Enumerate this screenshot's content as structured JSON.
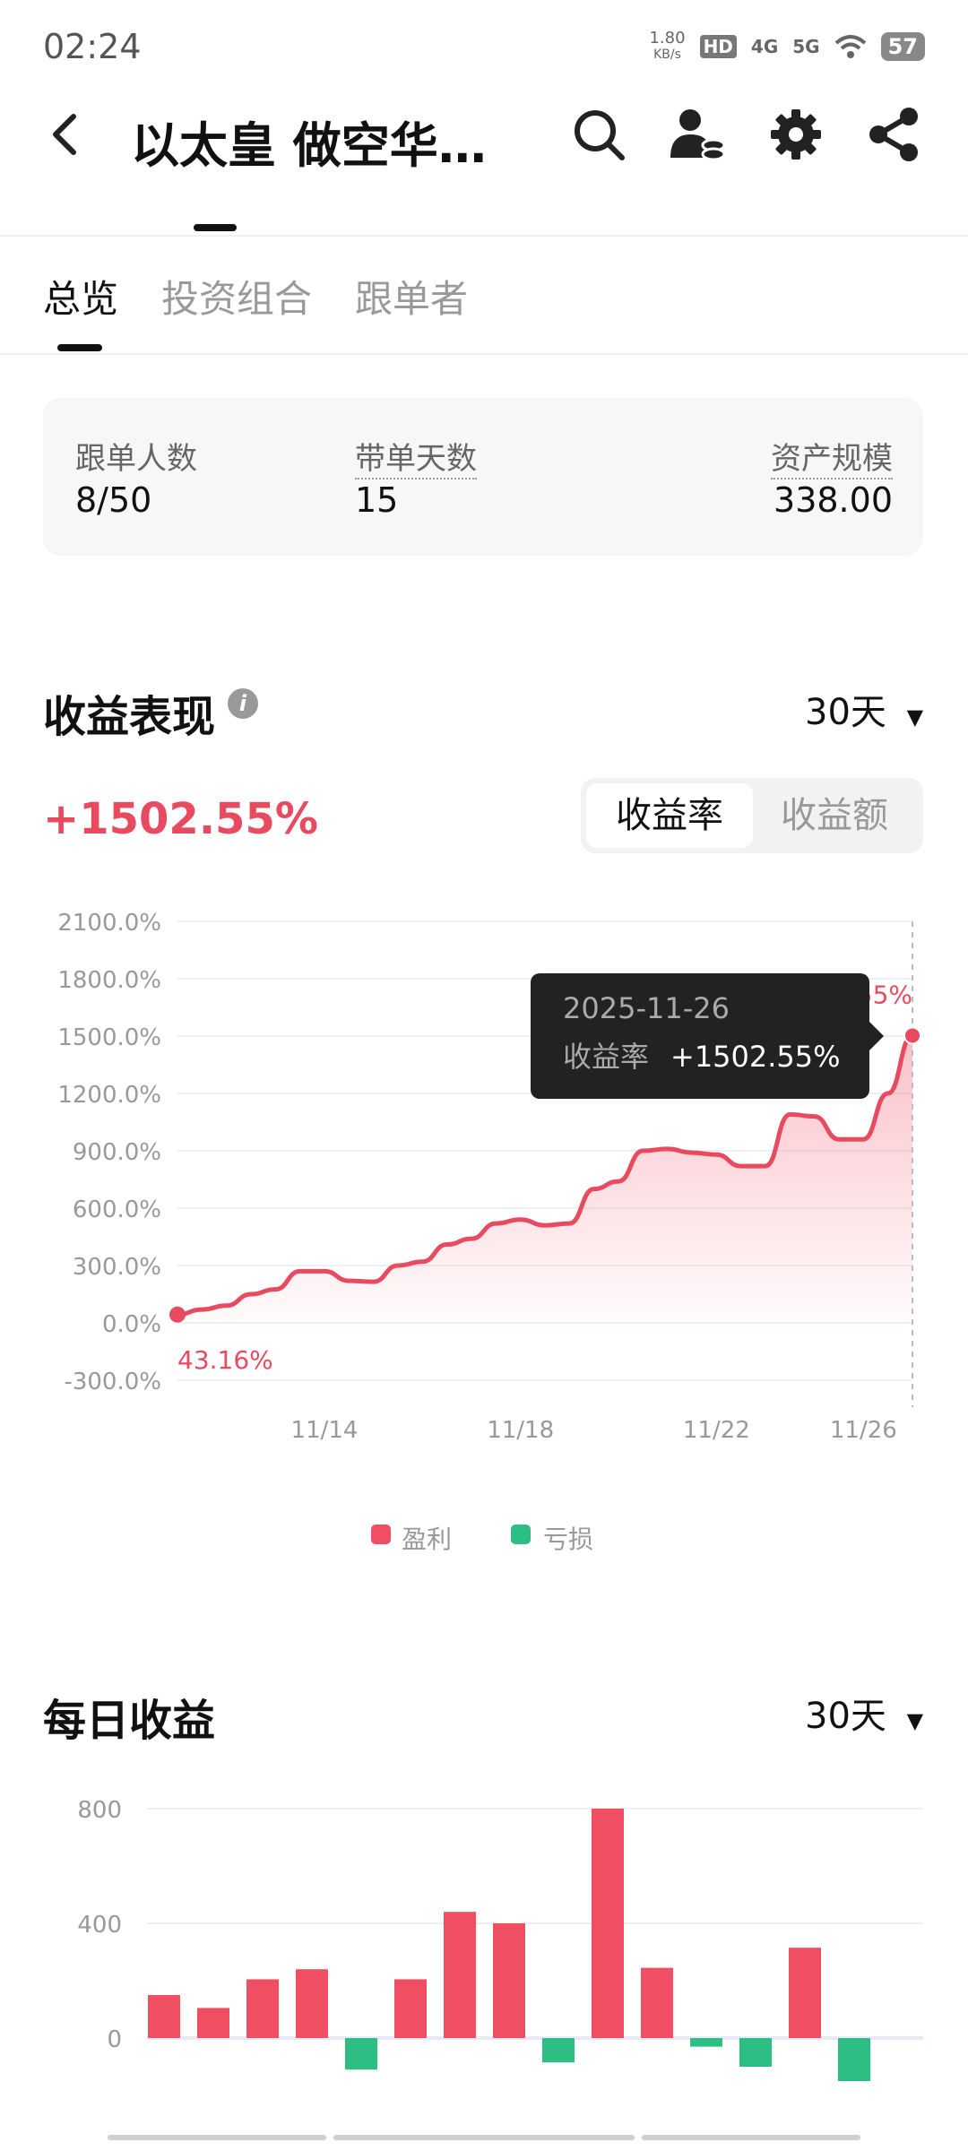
{
  "status_bar": {
    "time": "02:24",
    "net_speed": "1.80",
    "net_unit": "KB/s",
    "hd": "HD",
    "sim1": "4G",
    "sim2": "5G",
    "battery": "57"
  },
  "header": {
    "title": "以太皇 做空华…",
    "icons": [
      "back-icon",
      "search-icon",
      "user-icon",
      "gear-icon",
      "share-icon"
    ]
  },
  "tabs": [
    {
      "label": "总览",
      "active": true
    },
    {
      "label": "投资组合",
      "active": false
    },
    {
      "label": "跟单者",
      "active": false
    }
  ],
  "stats": {
    "followers_label": "跟单人数",
    "followers_value": "8/50",
    "days_label": "带单天数",
    "days_value": "15",
    "aum_label": "资产规模",
    "aum_value": "338.00"
  },
  "performance": {
    "title": "收益表现",
    "period": "30天",
    "total": "+1502.55%",
    "toggle_rate": "收益率",
    "toggle_amount": "收益额",
    "tooltip_date": "2025-11-26",
    "tooltip_label": "收益率",
    "tooltip_value": "+1502.55%",
    "end_label": "1502.55%",
    "start_label": "43.16%",
    "legend_profit": "盈利",
    "legend_loss": "亏损",
    "colors": {
      "profit": "#f04e63",
      "loss": "#2dbe84"
    }
  },
  "daily": {
    "title": "每日收益",
    "period": "30天"
  },
  "chart_data": [
    {
      "type": "area",
      "title": "",
      "y_ticks": [
        "2100.0%",
        "1800.0%",
        "1500.0%",
        "1200.0%",
        "900.0%",
        "600.0%",
        "300.0%",
        "0.0%",
        "-300.0%"
      ],
      "ylim": [
        -300,
        2100
      ],
      "x_ticks": [
        "11/14",
        "11/18",
        "11/22",
        "11/26"
      ],
      "x_tick_positions": [
        3,
        7,
        11,
        14
      ],
      "x": [
        0,
        0.5,
        1,
        1.5,
        2,
        2.5,
        3,
        3.5,
        4,
        4.5,
        5,
        5.5,
        6,
        6.5,
        7,
        7.5,
        8,
        8.5,
        9,
        9.5,
        10,
        10.5,
        11,
        11.5,
        12,
        12.5,
        13,
        13.5,
        14,
        14.5,
        15
      ],
      "values": [
        43.16,
        70,
        90,
        150,
        175,
        270,
        270,
        220,
        215,
        300,
        320,
        410,
        440,
        520,
        540,
        510,
        520,
        700,
        740,
        900,
        910,
        890,
        880,
        820,
        820,
        1090,
        1080,
        960,
        960,
        1200,
        1502.55
      ],
      "grid": true
    },
    {
      "type": "bar",
      "title": "",
      "y_ticks": [
        "800",
        "400",
        "0"
      ],
      "ylim": [
        -150,
        820
      ],
      "values": [
        150,
        105,
        205,
        240,
        -110,
        205,
        440,
        400,
        -85,
        800,
        245,
        -30,
        -100,
        315,
        -150
      ],
      "grid": true
    }
  ]
}
